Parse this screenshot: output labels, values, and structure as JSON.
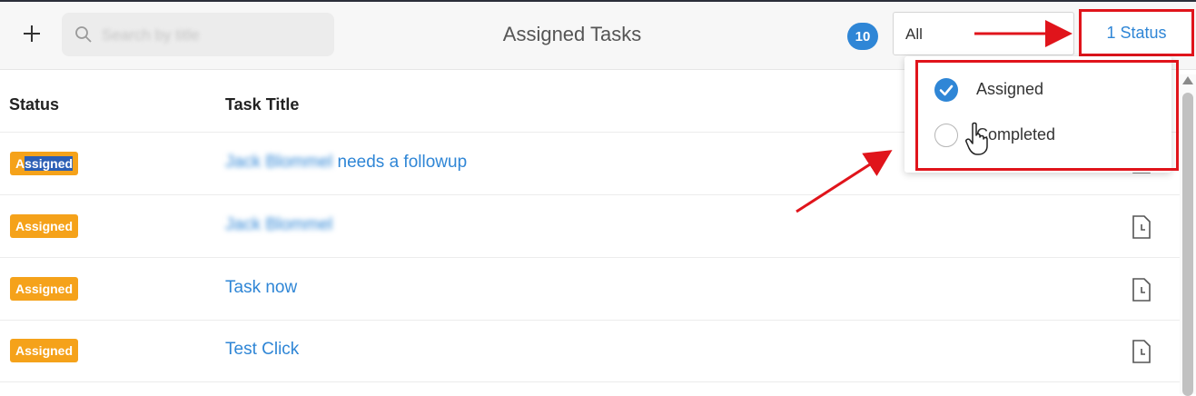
{
  "toolbar": {
    "search_placeholder": "Search by title",
    "page_title": "Assigned Tasks",
    "task_count": "10",
    "filter_value": "All",
    "status_button": "1 Status"
  },
  "table": {
    "headers": {
      "status": "Status",
      "title": "Task Title"
    },
    "rows": [
      {
        "status": "Assigned",
        "title_blurred": "Jack Blommel",
        "title": " needs a followup"
      },
      {
        "status": "Assigned",
        "title_blurred": "Jack Blommel",
        "title": ""
      },
      {
        "status": "Assigned",
        "title_blurred": "",
        "title": "Task now"
      },
      {
        "status": "Assigned",
        "title_blurred": "",
        "title": "Test Click"
      }
    ]
  },
  "status_dropdown": {
    "options": [
      {
        "label": "Assigned",
        "checked": true
      },
      {
        "label": "Completed",
        "checked": false
      }
    ]
  },
  "colors": {
    "accent": "#2f86d6",
    "badge": "#f5a21a",
    "annotation": "#e0141b"
  }
}
